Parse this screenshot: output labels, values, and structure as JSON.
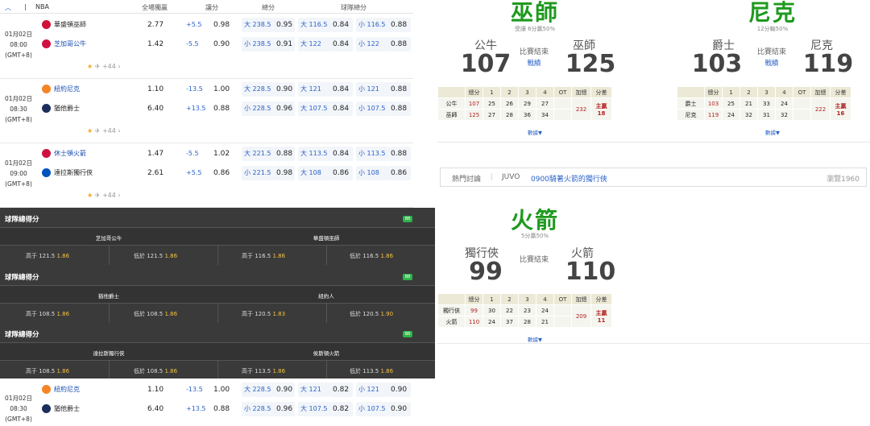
{
  "league": {
    "name": "NBA",
    "header": {
      "full": "全場獨贏",
      "hcap": "讓分",
      "total": "總分",
      "team_total": "球隊總分"
    }
  },
  "games": [
    {
      "date": "01月02日",
      "time": "08:00",
      "tz": "(GMT+8)",
      "more": "+44",
      "home": {
        "name": "華盛頓巫師",
        "ml": "2.77",
        "hcap": "+5.5",
        "hcap_odds": "0.98",
        "total": "大 238.5",
        "total_odds": "0.95",
        "tt_over": "大 116.5",
        "tt_over_odds": "0.84",
        "tt_under": "小 116.5",
        "tt_under_odds": "0.88"
      },
      "away": {
        "name": "芝加哥公牛",
        "ml": "1.42",
        "hcap": "-5.5",
        "hcap_odds": "0.90",
        "total": "小 238.5",
        "total_odds": "0.91",
        "tt_over": "大 122",
        "tt_over_odds": "0.84",
        "tt_under": "小 122",
        "tt_under_odds": "0.88"
      }
    },
    {
      "date": "01月02日",
      "time": "08:30",
      "tz": "(GMT+8)",
      "more": "+44",
      "home": {
        "name": "紐約尼克",
        "ml": "1.10",
        "hcap": "-13.5",
        "hcap_odds": "1.00",
        "total": "大 228.5",
        "total_odds": "0.90",
        "tt_over": "大 121",
        "tt_over_odds": "0.84",
        "tt_under": "小 121",
        "tt_under_odds": "0.88"
      },
      "away": {
        "name": "猶他爵士",
        "ml": "6.40",
        "hcap": "+13.5",
        "hcap_odds": "0.88",
        "total": "小 228.5",
        "total_odds": "0.96",
        "tt_over": "大 107.5",
        "tt_over_odds": "0.84",
        "tt_under": "小 107.5",
        "tt_under_odds": "0.88"
      }
    },
    {
      "date": "01月02日",
      "time": "09:00",
      "tz": "(GMT+8)",
      "more": "+44",
      "home": {
        "name": "休士頓火箭",
        "ml": "1.47",
        "hcap": "-5.5",
        "hcap_odds": "1.02",
        "total": "大 221.5",
        "total_odds": "0.88",
        "tt_over": "大 113.5",
        "tt_over_odds": "0.84",
        "tt_under": "小 113.5",
        "tt_under_odds": "0.88"
      },
      "away": {
        "name": "達拉斯獨行俠",
        "ml": "2.61",
        "hcap": "+5.5",
        "hcap_odds": "0.86",
        "total": "小 221.5",
        "total_odds": "0.98",
        "tt_over": "大 108",
        "tt_over_odds": "0.86",
        "tt_under": "小 108",
        "tt_under_odds": "0.86"
      }
    }
  ],
  "dark": [
    {
      "title": "球隊總得分",
      "t1": "芝加哥公牛",
      "t2": "華盛頓巫師",
      "c": [
        "高于 121.5",
        "1.86",
        "低於 121.5",
        "1.86",
        "高于 116.5",
        "1.86",
        "低於 116.5",
        "1.86"
      ]
    },
    {
      "title": "球隊總得分",
      "t1": "猶他爵士",
      "t2": "紐約人",
      "c": [
        "高于 108.5",
        "1.86",
        "低於 108.5",
        "1.86",
        "高于 120.5",
        "1.83",
        "低於 120.5",
        "1.90"
      ]
    },
    {
      "title": "球隊總得分",
      "t1": "達拉斯獨行俠",
      "t2": "侯斯頓火箭",
      "c": [
        "高于 108.5",
        "1.86",
        "低於 108.5",
        "1.86",
        "高于 113.5",
        "1.86",
        "低於 113.5",
        "1.86"
      ]
    }
  ],
  "dark_icon": "BB",
  "bottom_game": {
    "date": "01月02日",
    "time": "08:30",
    "tz": "(GMT+8)",
    "home": {
      "name": "紐約尼克",
      "ml": "1.10",
      "hcap": "-13.5",
      "hcap_odds": "1.00",
      "total": "大 228.5",
      "total_odds": "0.90",
      "tt_over": "大 121",
      "tt_over_odds": "0.82",
      "tt_under": "小 121",
      "tt_under_odds": "0.90"
    },
    "away": {
      "name": "猶他爵士",
      "ml": "6.40",
      "hcap": "+13.5",
      "hcap_odds": "0.88",
      "total": "小 228.5",
      "total_odds": "0.96",
      "tt_over": "大 107.5",
      "tt_over_odds": "0.82",
      "tt_under": "小 107.5",
      "tt_under_odds": "0.90"
    }
  },
  "boxes": [
    {
      "winner": "巫師",
      "sub": "受讓 6分贏50%",
      "t1": "公牛",
      "s1": "107",
      "t2": "巫師",
      "s2": "125",
      "status": "比賽結束",
      "link": "戰績",
      "head": [
        "總分",
        "1",
        "2",
        "3",
        "4",
        "OT",
        "加總",
        "分差"
      ],
      "r1": [
        "公牛",
        "107",
        "25",
        "26",
        "29",
        "27",
        "",
        ""
      ],
      "r2": [
        "巫師",
        "125",
        "27",
        "28",
        "36",
        "34",
        "",
        ""
      ],
      "sum": "232",
      "diff": "主贏 18",
      "more": "數據▼"
    },
    {
      "winner": "尼克",
      "sub": "12分輸50%",
      "t1": "爵士",
      "s1": "103",
      "t2": "尼克",
      "s2": "119",
      "status": "比賽結束",
      "link": "戰績",
      "head": [
        "總分",
        "1",
        "2",
        "3",
        "4",
        "OT",
        "加總",
        "分差"
      ],
      "r1": [
        "爵士",
        "103",
        "25",
        "21",
        "33",
        "24",
        "",
        ""
      ],
      "r2": [
        "尼克",
        "119",
        "24",
        "32",
        "31",
        "32",
        "",
        ""
      ],
      "sum": "222",
      "diff": "主贏 16",
      "more": "數據▼"
    },
    {
      "winner": "火箭",
      "sub": "5分贏50%",
      "t1": "獨行俠",
      "s1": "99",
      "t2": "火箭",
      "s2": "110",
      "status": "比賽結束",
      "link": "",
      "head": [
        "總分",
        "1",
        "2",
        "3",
        "4",
        "OT",
        "加總",
        "分差"
      ],
      "r1": [
        "獨行俠",
        "99",
        "30",
        "22",
        "23",
        "24",
        "",
        ""
      ],
      "r2": [
        "火箭",
        "110",
        "24",
        "37",
        "28",
        "21",
        "",
        ""
      ],
      "sum": "209",
      "diff": "主贏 11",
      "more": "數據▼"
    }
  ],
  "discussion": {
    "label": "熱門討論",
    "user": "JUVO",
    "text": "0900騎著火箭的獨行俠",
    "views": "瀏覽1960"
  },
  "colors": {
    "green": "#1e9a1e",
    "link": "#2a62c9",
    "dark": "#3a3a3a",
    "gold": "#f5c342"
  }
}
